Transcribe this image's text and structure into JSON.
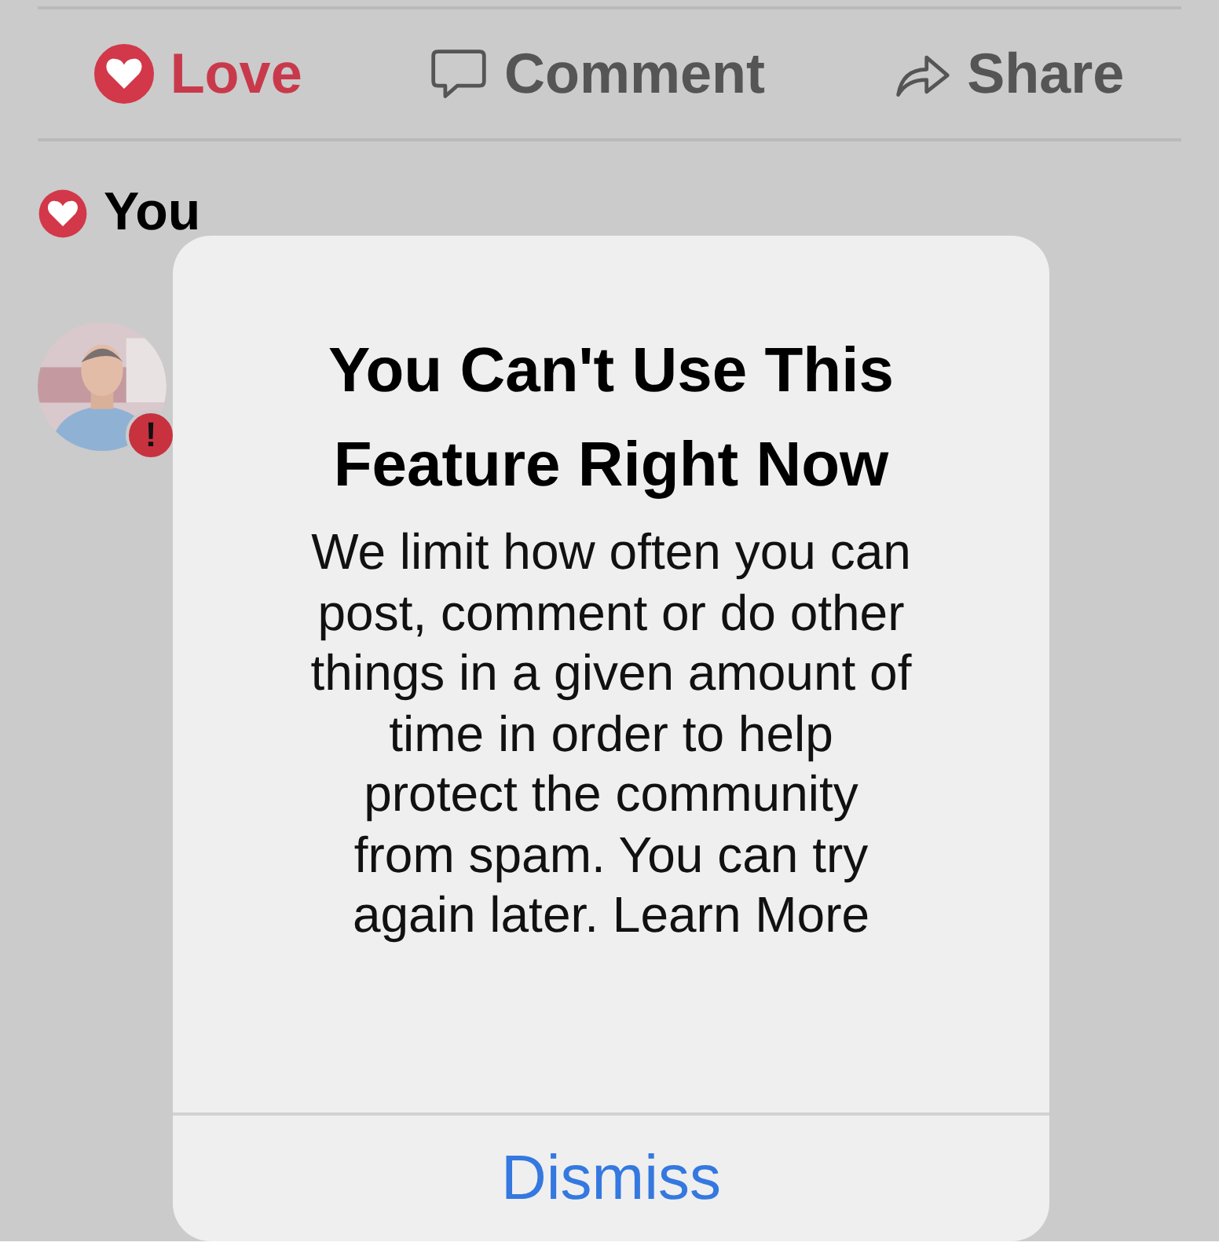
{
  "actions": [
    {
      "label": "Love",
      "kind": "love",
      "selected": true
    },
    {
      "label": "Comment",
      "kind": "comment",
      "selected": false
    },
    {
      "label": "Share",
      "kind": "share",
      "selected": false
    }
  ],
  "reactors": {
    "label": "You"
  },
  "comment": {
    "avatar": {
      "kind": "picture",
      "badge": "!"
    }
  },
  "dialog": {
    "title_lines": [
      "You Can't Use This",
      "Feature Right Now"
    ],
    "message_lines": [
      "We limit how often you can",
      "post, comment or do other",
      "things in a given amount of",
      "time in order to help",
      "protect the community",
      "from spam. You can try",
      "again later. Learn More"
    ],
    "button": "Dismiss"
  }
}
